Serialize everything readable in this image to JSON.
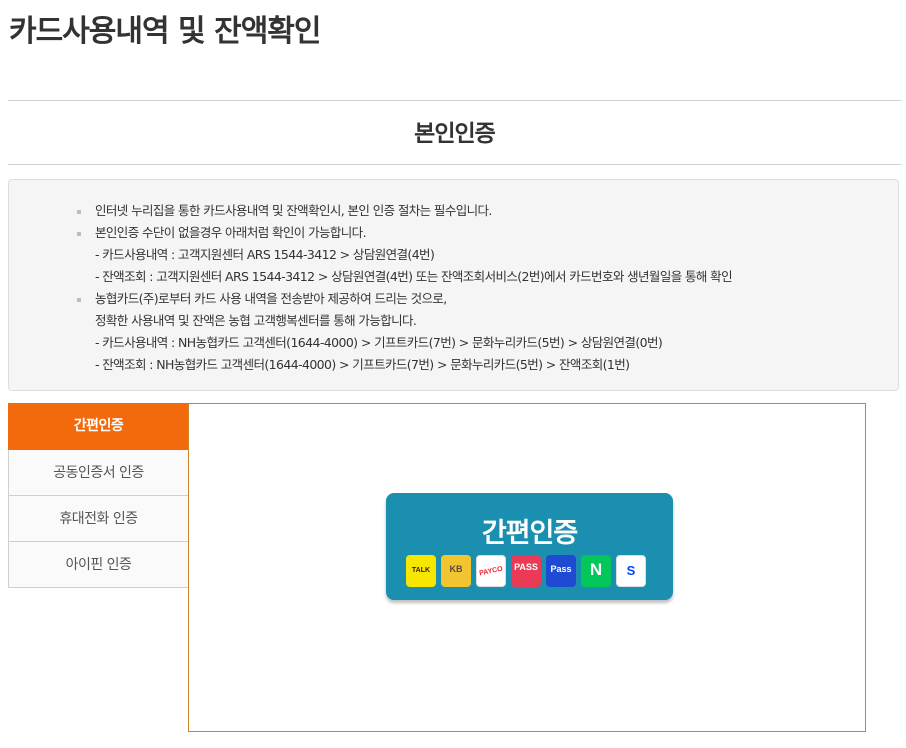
{
  "page": {
    "title": "카드사용내역 및 잔액확인",
    "section_title": "본인인증"
  },
  "notice": {
    "items": [
      {
        "lines": [
          "인터넷 누리집을 통한 카드사용내역 및 잔액확인시, 본인 인증 절차는 필수입니다."
        ]
      },
      {
        "lines": [
          "본인인증 수단이 없을경우 아래처럼 확인이 가능합니다.",
          "- 카드사용내역 : 고객지원센터 ARS 1544-3412 > 상담원연결(4번)",
          "- 잔액조회 : 고객지원센터 ARS 1544-3412 > 상담원연결(4번) 또는 잔액조회서비스(2번)에서 카드번호와 생년월일을 통해 확인"
        ]
      },
      {
        "lines": [
          "농협카드(주)로부터 카드 사용 내역을 전송받아 제공하여 드리는 것으로,",
          "정확한 사용내역 및 잔액은 농협 고객행복센터를 통해 가능합니다.",
          "- 카드사용내역 : NH농협카드 고객센터(1644-4000) > 기프트카드(7번) > 문화누리카드(5번) > 상담원연결(0번)",
          "- 잔액조회 : NH농협카드 고객센터(1644-4000) > 기프트카드(7번) > 문화누리카드(5번) > 잔액조회(1번)"
        ]
      }
    ]
  },
  "tabs": [
    {
      "label": "간편인증",
      "active": true
    },
    {
      "label": "공동인증서 인증",
      "active": false
    },
    {
      "label": "휴대전화 인증",
      "active": false
    },
    {
      "label": "아이핀 인증",
      "active": false
    }
  ],
  "easy_auth": {
    "label": "간편인증",
    "providers": [
      {
        "name": "kakao-icon",
        "text": "TALK",
        "bg": "#f7e600",
        "fg": "#3a1d1d"
      },
      {
        "name": "kb-icon",
        "text": "KB",
        "bg": "#f2c42f",
        "fg": "#5a4a3a"
      },
      {
        "name": "payco-icon",
        "text": "PAYCO",
        "bg": "#ffffff",
        "fg": "#e8242f"
      },
      {
        "name": "pass-icon",
        "text": "PASS",
        "bg": "#ea3a55",
        "fg": "#ffffff"
      },
      {
        "name": "samsung-pass-icon",
        "text": "Pass",
        "bg": "#1e4bd2",
        "fg": "#ffffff"
      },
      {
        "name": "naver-icon",
        "text": "N",
        "bg": "#03c75a",
        "fg": "#ffffff"
      },
      {
        "name": "shinhan-icon",
        "text": "S",
        "bg": "#ffffff",
        "fg": "#0046ff"
      }
    ]
  }
}
